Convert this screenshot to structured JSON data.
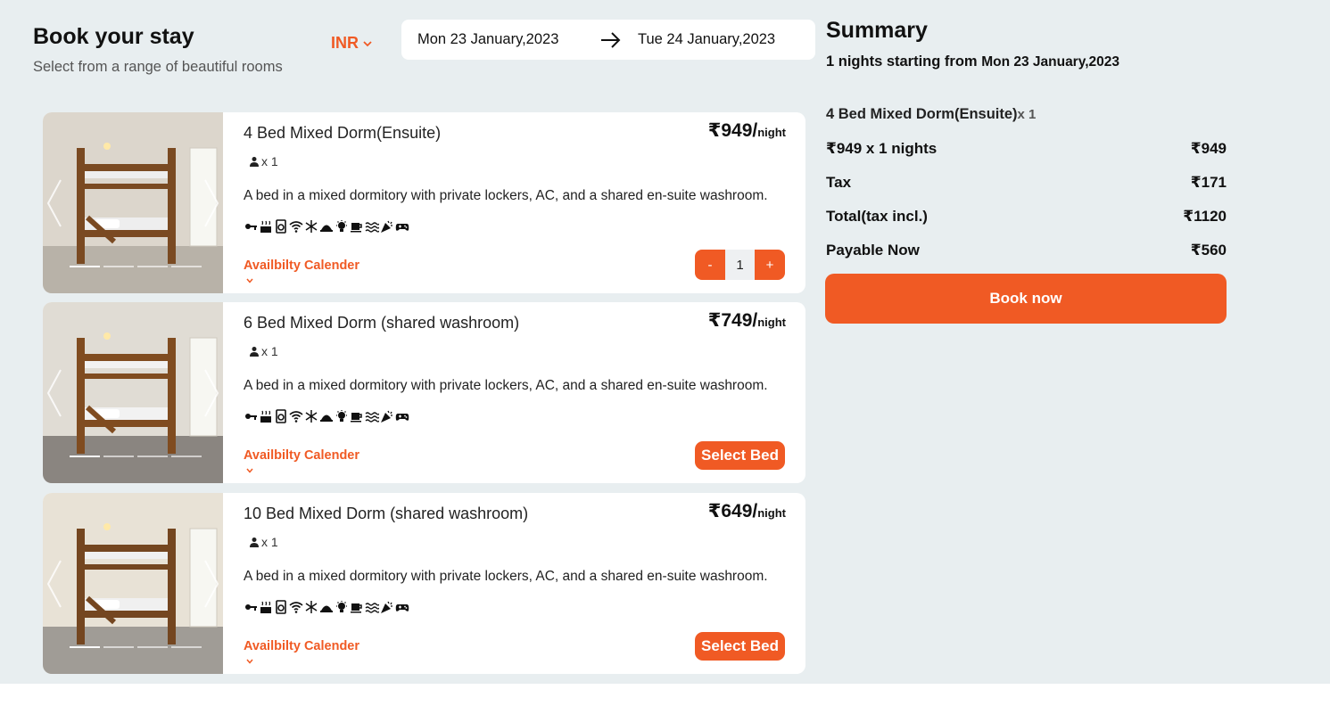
{
  "header": {
    "title": "Book your stay",
    "subtitle": "Select from a range of beautiful rooms",
    "currency": "INR",
    "check_in": "Mon 23 January,2023",
    "check_out": "Tue 24 January,2023"
  },
  "rooms": [
    {
      "name": "4 Bed Mixed Dorm(Ensuite)",
      "price": "₹949/",
      "per": "night",
      "guests": "x 1",
      "description": "A bed in a mixed dormitory with private lockers, AC, and a shared en-suite washroom.",
      "availability": "Availbilty Calender",
      "action": "stepper",
      "quantity": "1",
      "minus": "-",
      "plus": "+"
    },
    {
      "name": "6 Bed Mixed Dorm (shared washroom)",
      "price": "₹749/",
      "per": "night",
      "guests": "x 1",
      "description": "A bed in a mixed dormitory with private lockers, AC, and a shared en-suite washroom.",
      "availability": "Availbilty Calender",
      "action": "select",
      "select_label": "Select Bed"
    },
    {
      "name": "10 Bed Mixed Dorm (shared washroom)",
      "price": "₹649/",
      "per": "night",
      "guests": "x 1",
      "description": "A bed in a mixed dormitory with private lockers, AC, and a shared en-suite washroom.",
      "availability": "Availbilty Calender",
      "action": "select",
      "select_label": "Select Bed"
    }
  ],
  "amenity_icons": [
    "key-icon",
    "heater-icon",
    "washing-machine-icon",
    "wifi-icon",
    "snowflake-icon",
    "room-service-icon",
    "lamp-icon",
    "coffee-icon",
    "waves-icon",
    "party-icon",
    "gamepad-icon"
  ],
  "summary": {
    "title": "Summary",
    "nights_text": "1 nights starting from ",
    "start_date": "Mon 23 January,2023",
    "room_name": "4 Bed Mixed Dorm(Ensuite)",
    "room_qty": "x 1",
    "rows": [
      {
        "label": "₹949 x 1 nights",
        "value": "₹949"
      },
      {
        "label": "Tax",
        "value": "₹171"
      },
      {
        "label": "Total(tax incl.)",
        "value": "₹1120"
      },
      {
        "label": "Payable Now",
        "value": "₹560"
      }
    ],
    "book_label": "Book now"
  },
  "colors": {
    "accent": "#f05a24",
    "background": "#e8eef0",
    "card": "#ffffff"
  }
}
